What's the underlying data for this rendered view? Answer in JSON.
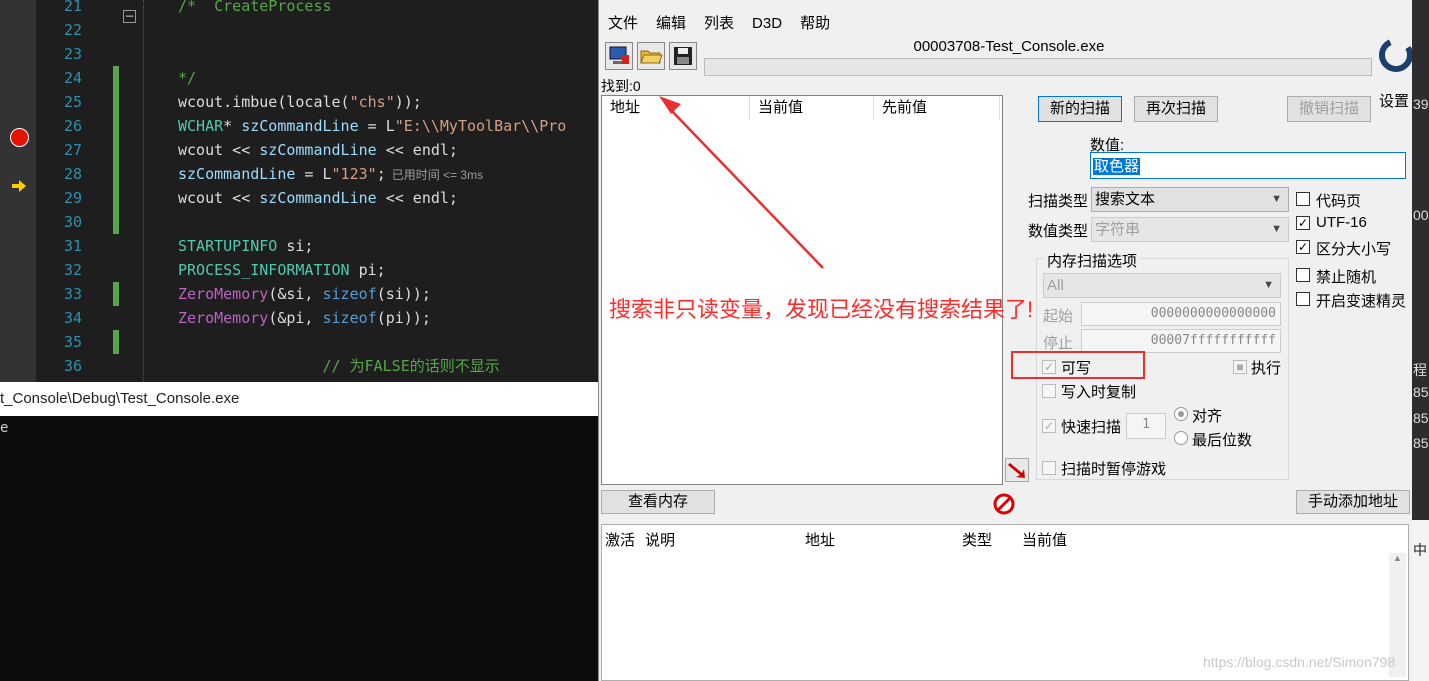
{
  "editor": {
    "lines": [
      {
        "num": "21",
        "parts": [
          {
            "c": "cm",
            "t": "/*  CreateProcess"
          }
        ]
      },
      {
        "num": "22",
        "parts": []
      },
      {
        "num": "23",
        "parts": []
      },
      {
        "num": "24",
        "parts": [
          {
            "c": "cm",
            "t": "*/"
          }
        ]
      },
      {
        "num": "25",
        "parts": [
          {
            "c": "",
            "t": "wcout.imbue(locale("
          },
          {
            "c": "str",
            "t": "\"chs\""
          },
          {
            "c": "",
            "t": "));"
          }
        ]
      },
      {
        "num": "26",
        "parts": [
          {
            "c": "ty",
            "t": "WCHAR"
          },
          {
            "c": "",
            "t": "* "
          },
          {
            "c": "var",
            "t": "szCommandLine"
          },
          {
            "c": "",
            "t": " = L"
          },
          {
            "c": "str",
            "t": "\"E:\\\\MyToolBar\\\\Pro"
          }
        ]
      },
      {
        "num": "27",
        "parts": [
          {
            "c": "",
            "t": "wcout << "
          },
          {
            "c": "var",
            "t": "szCommandLine"
          },
          {
            "c": "",
            "t": " << endl;"
          }
        ]
      },
      {
        "num": "28",
        "parts": [
          {
            "c": "var",
            "t": "szCommandLine"
          },
          {
            "c": "",
            "t": " = L"
          },
          {
            "c": "str",
            "t": "\"123\""
          },
          {
            "c": "",
            "t": ";"
          }
        ],
        "hint": "已用时间 <= 3ms"
      },
      {
        "num": "29",
        "parts": [
          {
            "c": "",
            "t": "wcout << "
          },
          {
            "c": "var",
            "t": "szCommandLine"
          },
          {
            "c": "",
            "t": " << endl;"
          }
        ]
      },
      {
        "num": "30",
        "parts": []
      },
      {
        "num": "31",
        "parts": [
          {
            "c": "ty",
            "t": "STARTUPINFO"
          },
          {
            "c": "",
            "t": " si;"
          }
        ]
      },
      {
        "num": "32",
        "parts": [
          {
            "c": "ty",
            "t": "PROCESS_INFORMATION"
          },
          {
            "c": "",
            "t": " pi;"
          }
        ]
      },
      {
        "num": "33",
        "parts": [
          {
            "c": "mac",
            "t": "ZeroMemory"
          },
          {
            "c": "",
            "t": "(&si, "
          },
          {
            "c": "kw",
            "t": "sizeof"
          },
          {
            "c": "",
            "t": "(si));"
          }
        ]
      },
      {
        "num": "34",
        "parts": [
          {
            "c": "mac",
            "t": "ZeroMemory"
          },
          {
            "c": "",
            "t": "(&pi, "
          },
          {
            "c": "kw",
            "t": "sizeof"
          },
          {
            "c": "",
            "t": "(pi));"
          }
        ]
      },
      {
        "num": "35",
        "parts": []
      },
      {
        "num": "36",
        "parts": [
          {
            "c": "cm",
            "t": "                // 为FALSE的话则不显示"
          }
        ]
      }
    ]
  },
  "console": {
    "title": "t_Console\\Debug\\Test_Console.exe",
    "text": "e"
  },
  "ce": {
    "menu": [
      "文件",
      "编辑",
      "列表",
      "D3D",
      "帮助"
    ],
    "process_title": "00003708-Test_Console.exe",
    "found": "找到:0",
    "columns": [
      "地址",
      "当前值",
      "先前值"
    ],
    "new_scan": "新的扫描",
    "next_scan": "再次扫描",
    "undo_scan": "撤销扫描",
    "settings": "设置",
    "value_label": "数值:",
    "value": "取色器",
    "scan_type_label": "扫描类型",
    "scan_type": "搜索文本",
    "value_type_label": "数值类型",
    "value_type": "字符串",
    "options": {
      "code_page": "代码页",
      "utf16": "UTF-16",
      "case_sensitive": "区分大小写",
      "no_random": "禁止随机",
      "speedhack": "开启变速精灵"
    },
    "mem_options": {
      "title": "内存扫描选项",
      "region": "All",
      "start_label": "起始",
      "start": "0000000000000000",
      "stop_label": "停止",
      "stop": "00007fffffffffff",
      "writable": "可写",
      "executable": "执行",
      "copy_on_write": "写入时复制",
      "fast_scan": "快速扫描",
      "fast_value": "1",
      "align": "对齐",
      "last_digits": "最后位数",
      "pause": "扫描时暂停游戏"
    },
    "view_memory": "查看内存",
    "add_address": "手动添加地址",
    "bottom_columns": [
      "激活",
      "说明",
      "地址",
      "类型",
      "当前值"
    ],
    "annotation": "搜索非只读变量，发现已经没有搜索结果了!",
    "watermark": "https://blog.csdn.net/Simon798"
  },
  "edge": {
    "texts": [
      "39",
      "00",
      "程",
      "85",
      "85",
      "85",
      "中"
    ]
  },
  "colors": {
    "annotation": "#ff2b2b",
    "accent": "#0078d7"
  }
}
